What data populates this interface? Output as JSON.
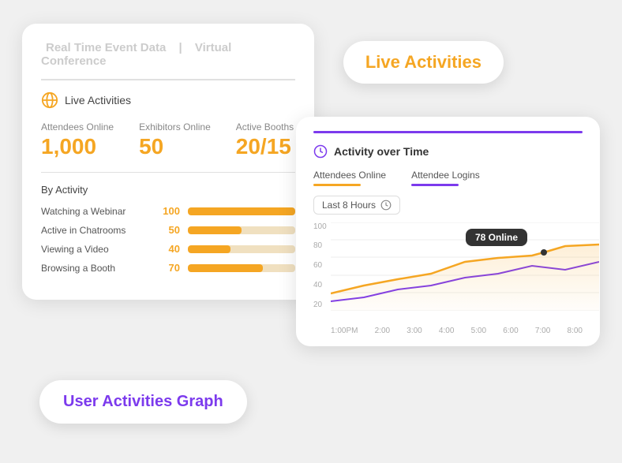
{
  "callout": {
    "label": "Live Activities"
  },
  "card_left": {
    "title": "Real Time Event Data",
    "separator": "|",
    "subtitle": "Virtual Conference",
    "live_label": "Live Activities",
    "stats": [
      {
        "label": "Attendees Online",
        "value": "1,000"
      },
      {
        "label": "Exhibitors Online",
        "value": "50"
      },
      {
        "label": "Active Booths",
        "value": "20/15"
      }
    ],
    "by_activity_label": "By Activity",
    "activities": [
      {
        "name": "Watching a Webinar",
        "count": "100",
        "pct": 100
      },
      {
        "name": "Active in Chatrooms",
        "count": "50",
        "pct": 50
      },
      {
        "name": "Viewing a Video",
        "count": "40",
        "pct": 40
      },
      {
        "name": "Browsing a Booth",
        "count": "70",
        "pct": 70
      }
    ]
  },
  "card_right": {
    "title": "Activity over Time",
    "legend": [
      {
        "label": "Attendees Online",
        "color": "orange"
      },
      {
        "label": "Attendee Logins",
        "color": "purple"
      }
    ],
    "time_filter": "Last 8 Hours",
    "tooltip": "78 Online",
    "y_labels": [
      "100",
      "80",
      "60",
      "40",
      "20"
    ],
    "x_labels": [
      "1:00PM",
      "2:00",
      "3:00",
      "4:00",
      "5:00",
      "6:00",
      "7:00",
      "8:00"
    ]
  },
  "user_activities_bubble": {
    "label": "User Activities Graph"
  },
  "colors": {
    "orange": "#f5a623",
    "purple": "#7c3aed",
    "dark": "#333"
  }
}
